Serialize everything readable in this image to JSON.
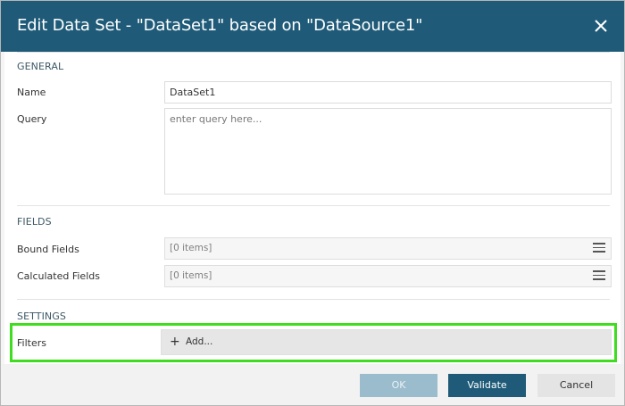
{
  "dialog": {
    "title": "Edit Data Set - \"DataSet1\" based on \"DataSource1\""
  },
  "sections": {
    "general": "GENERAL",
    "fields": "FIELDS",
    "settings": "SETTINGS"
  },
  "general": {
    "name_label": "Name",
    "name_value": "DataSet1",
    "query_label": "Query",
    "query_placeholder": "enter query here..."
  },
  "fields": {
    "bound_label": "Bound Fields",
    "bound_value": "[0 items]",
    "calculated_label": "Calculated Fields",
    "calculated_value": "[0 items]"
  },
  "settings": {
    "filters_label": "Filters",
    "add_icon": "+",
    "add_label": "Add..."
  },
  "footer": {
    "ok_label": "OK",
    "validate_label": "Validate",
    "cancel_label": "Cancel"
  },
  "colors": {
    "header": "#1f5b78",
    "ok_disabled": "#9bbccc",
    "highlight": "#3fdc1f"
  }
}
